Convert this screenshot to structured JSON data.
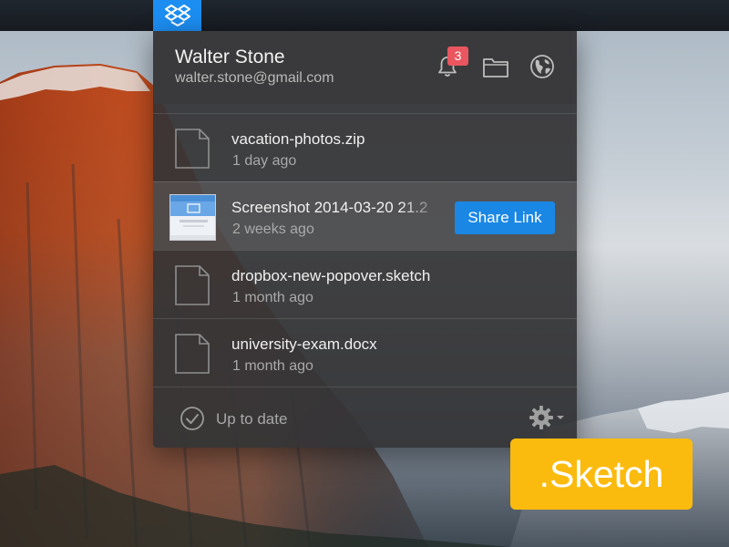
{
  "user": {
    "name": "Walter Stone",
    "email": "walter.stone@gmail.com",
    "notification_count": "3"
  },
  "header_icons": [
    "bell-icon",
    "folder-icon",
    "globe-icon"
  ],
  "files": [
    {
      "name": "vacation-photos.zip",
      "time": "1 day ago",
      "icon": "document-icon"
    },
    {
      "name": "Screenshot 2014-03-20 21.2",
      "time": "2 weeks ago",
      "icon": "screenshot-thumbnail",
      "action": "Share Link"
    },
    {
      "name": "dropbox-new-popover.sketch",
      "time": "1 month ago",
      "icon": "document-icon"
    },
    {
      "name": "university-exam.docx",
      "time": "1 month ago",
      "icon": "document-icon"
    }
  ],
  "footer": {
    "status": "Up to date"
  },
  "badge": {
    "label": ".Sketch"
  },
  "colors": {
    "dropbox_blue": "#1c8ef2",
    "share_button": "#1a87e4",
    "notification_badge": "#e9565f",
    "sketch_badge": "#fbbb0e"
  }
}
